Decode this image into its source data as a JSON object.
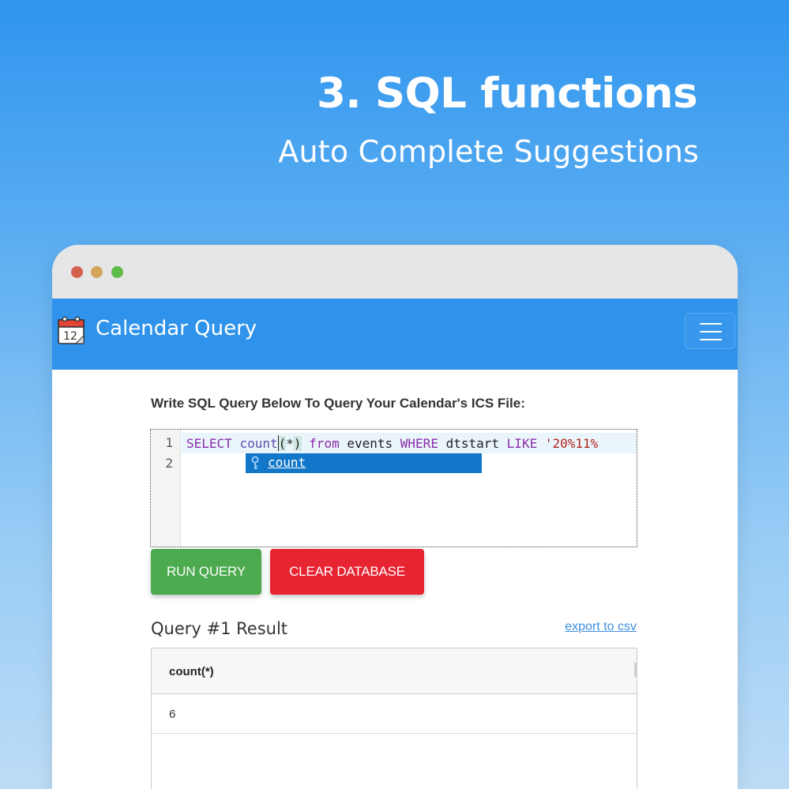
{
  "promo": {
    "title": "3. SQL functions",
    "subtitle": "Auto Complete Suggestions"
  },
  "app": {
    "title": "Calendar Query",
    "icon": "calendar-icon",
    "calendar_day": "12",
    "menu_icon": "hamburger-menu-icon"
  },
  "colors": {
    "navbar": "#2f93ec",
    "run_button": "#4caa4f",
    "clear_button": "#e72432",
    "autocomplete_highlight": "#1276c9"
  },
  "editor": {
    "label": "Write SQL Query Below To Query Your Calendar's ICS File:",
    "line_numbers": [
      "1",
      "2"
    ],
    "line1": {
      "select": "SELECT",
      "func": "count",
      "paren_open": "(",
      "star": "*",
      "paren_close": ")",
      "from": "from",
      "table": "events",
      "where": "WHERE",
      "column": "dtstart",
      "like": "LIKE",
      "pattern": "'20%11%"
    },
    "autocomplete": {
      "icon": "key-icon",
      "suggestion": "count"
    }
  },
  "actions": {
    "run": "RUN QUERY",
    "clear": "CLEAR DATABASE"
  },
  "result": {
    "title": "Query #1 Result",
    "export": "export to csv",
    "columns": [
      "count(*)"
    ],
    "rows": [
      [
        "6"
      ]
    ]
  }
}
